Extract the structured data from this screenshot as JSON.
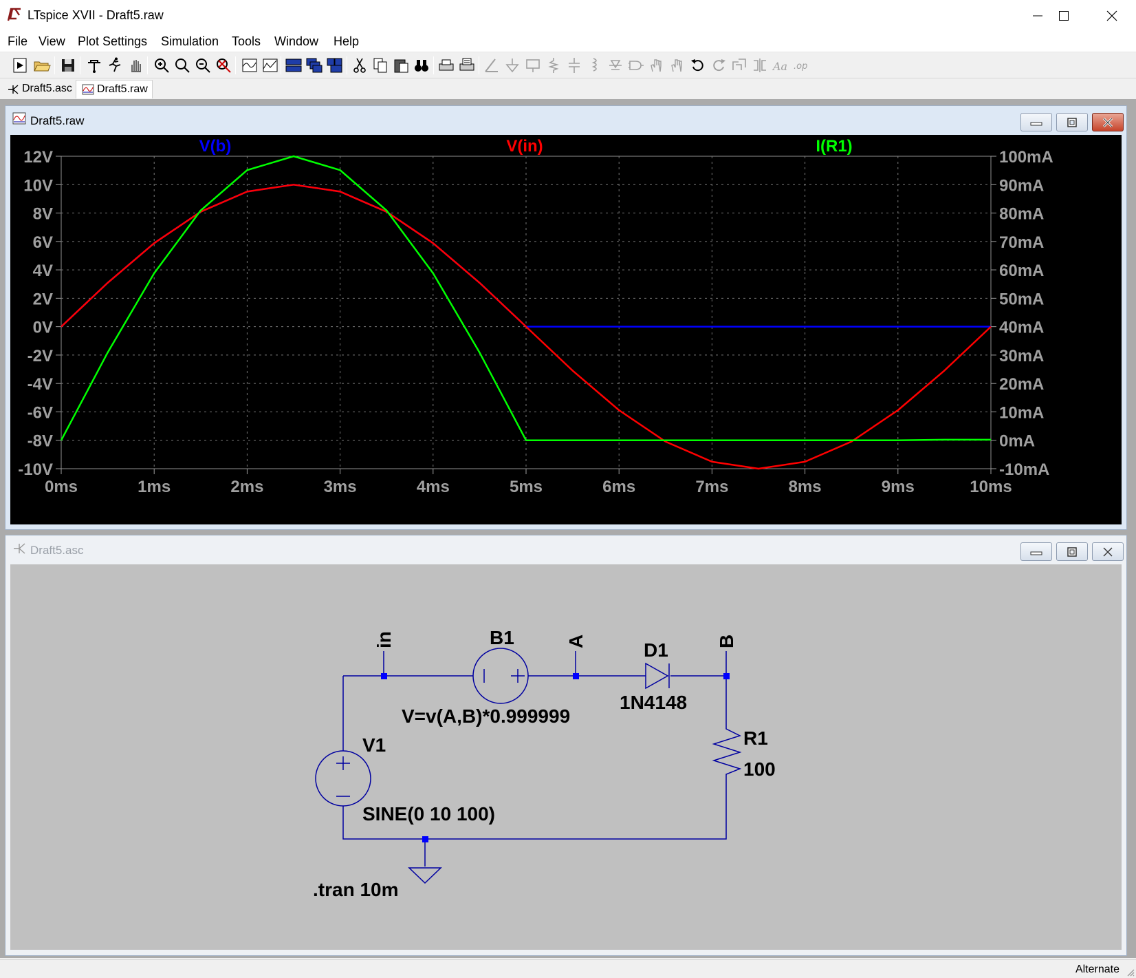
{
  "window": {
    "title": "LTspice XVII - Draft5.raw"
  },
  "menu": {
    "items": [
      "File",
      "View",
      "Plot Settings",
      "Simulation",
      "Tools",
      "Window",
      "Help"
    ]
  },
  "tabs": [
    {
      "label": "Draft5.asc",
      "icon": "schematic-icon"
    },
    {
      "label": "Draft5.raw",
      "icon": "waveform-icon"
    }
  ],
  "plot_window": {
    "title": "Draft5.raw"
  },
  "schematic_window": {
    "title": "Draft5.asc"
  },
  "chart_data": {
    "type": "line",
    "background": "#000000",
    "grid": "dashed",
    "x": {
      "unit": "ms",
      "range": [
        0,
        10
      ],
      "ticks": [
        "0ms",
        "1ms",
        "2ms",
        "3ms",
        "4ms",
        "5ms",
        "6ms",
        "7ms",
        "8ms",
        "9ms",
        "10ms"
      ]
    },
    "y_left": {
      "unit": "V",
      "range": [
        -10,
        12
      ],
      "ticks": [
        "12V",
        "10V",
        "8V",
        "6V",
        "4V",
        "2V",
        "0V",
        "-2V",
        "-4V",
        "-6V",
        "-8V",
        "-10V"
      ]
    },
    "y_right": {
      "unit": "mA",
      "range": [
        -10,
        100
      ],
      "ticks": [
        "100mA",
        "90mA",
        "80mA",
        "70mA",
        "60mA",
        "50mA",
        "40mA",
        "30mA",
        "20mA",
        "10mA",
        "0mA",
        "-10mA"
      ]
    },
    "series": [
      {
        "name": "V(b)",
        "color": "#0000ff",
        "axis": "left",
        "x": [
          0,
          0.5,
          1,
          1.5,
          2,
          2.5,
          3,
          3.5,
          4,
          4.5,
          5,
          5.5,
          6,
          6.5,
          7,
          7.5,
          8,
          8.5,
          9,
          9.5,
          10
        ],
        "y": [
          0,
          3.09,
          5.88,
          8.09,
          9.51,
          10,
          9.51,
          8.09,
          5.88,
          3.09,
          0,
          0,
          0,
          0,
          0,
          0,
          0,
          0,
          0,
          0,
          0
        ]
      },
      {
        "name": "V(in)",
        "color": "#ff0000",
        "axis": "left",
        "x": [
          0,
          0.5,
          1,
          1.5,
          2,
          2.5,
          3,
          3.5,
          4,
          4.5,
          5,
          5.5,
          6,
          6.5,
          7,
          7.5,
          8,
          8.5,
          9,
          9.5,
          10
        ],
        "y": [
          0,
          3.09,
          5.88,
          8.09,
          9.51,
          10,
          9.51,
          8.09,
          5.88,
          3.09,
          0,
          -3.09,
          -5.88,
          -8.09,
          -9.51,
          -10,
          -9.51,
          -8.09,
          -5.88,
          -3.09,
          0
        ]
      },
      {
        "name": "I(R1)",
        "color": "#00ff00",
        "axis": "right",
        "x": [
          0,
          0.5,
          1,
          1.5,
          2,
          2.5,
          3,
          3.5,
          4,
          4.5,
          5,
          5.5,
          6,
          6.5,
          7,
          7.5,
          8,
          8.5,
          9,
          9.5,
          10
        ],
        "y": [
          0,
          30.9,
          58.8,
          80.9,
          95.1,
          100,
          95.1,
          80.9,
          58.8,
          30.9,
          0,
          0,
          0,
          0,
          0,
          0,
          0,
          0,
          0,
          0.2,
          0.2
        ]
      }
    ]
  },
  "schematic": {
    "labels": {
      "net_in": "in",
      "net_a": "A",
      "net_b": "B",
      "b1_name": "B1",
      "b1_expr": "V=v(A,B)*0.999999",
      "d1_name": "D1",
      "d1_model": "1N4148",
      "r1_name": "R1",
      "r1_value": "100",
      "v1_name": "V1",
      "v1_value": "SINE(0 10 100)",
      "directive": ".tran 10m"
    },
    "wire_color": "#0000a0",
    "junction_color": "#0000ff"
  },
  "status": {
    "text": "Alternate"
  }
}
